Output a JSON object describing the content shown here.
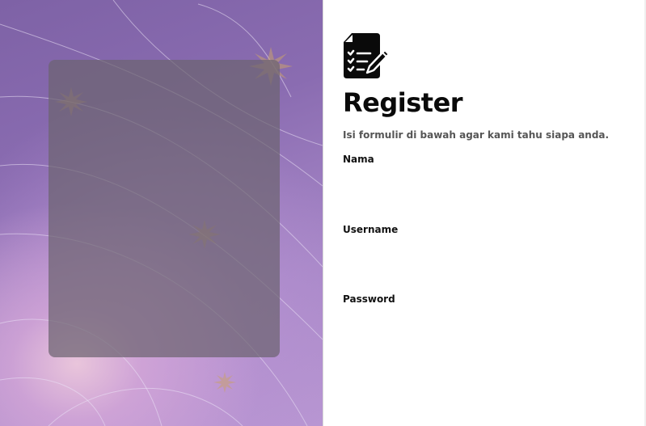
{
  "form": {
    "logo_icon": "form-checklist-pencil-icon",
    "title": "Register",
    "subtitle": "Isi formulir di bawah agar kami tahu siapa anda.",
    "fields": [
      {
        "label": "Nama",
        "value": "",
        "type": "text"
      },
      {
        "label": "Username",
        "value": "",
        "type": "text"
      },
      {
        "label": "Password",
        "value": "",
        "type": "password"
      }
    ]
  },
  "colors": {
    "panel_purple": "#8a6cb1",
    "panel_glow": "#ecc8dc",
    "card": "#6c6470",
    "text_primary": "#0a0a0a",
    "text_secondary": "#555555"
  }
}
